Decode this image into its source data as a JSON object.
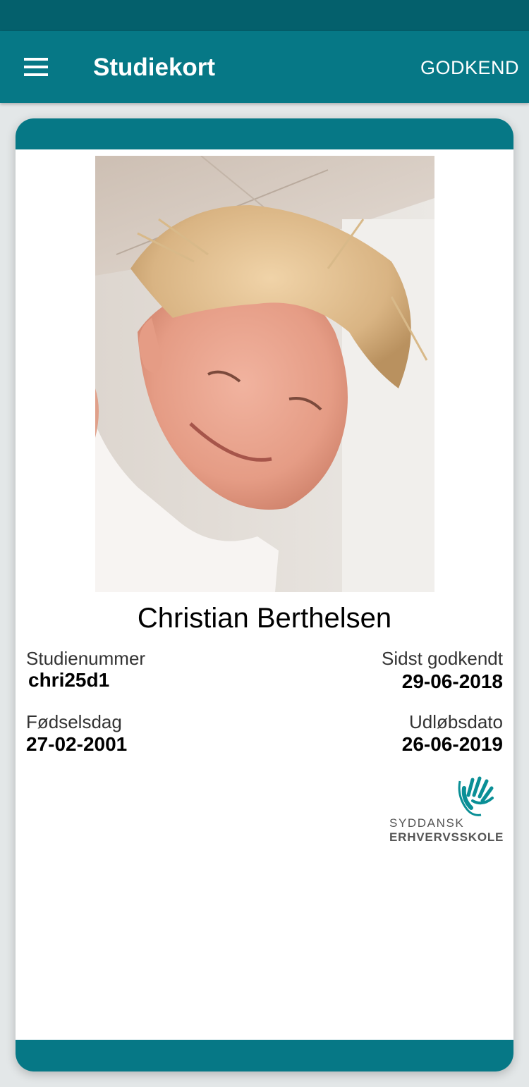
{
  "app_bar": {
    "title": "Studiekort",
    "approve_label": "GODKEND",
    "color": "#067886"
  },
  "card": {
    "name": "Christian Berthelsen",
    "student_number_label": "Studienummer",
    "student_number": "chri25d1",
    "last_approved_label": "Sidst godkendt",
    "last_approved": "29-06-2018",
    "birthday_label": "Fødselsdag",
    "birthday": "27-02-2001",
    "expiry_label": "Udløbsdato",
    "expiry": "26-06-2019"
  },
  "logo": {
    "line1": "SYDDANSK",
    "line2": "ERHVERVSSKOLE",
    "icon": "hand-icon",
    "color": "#0a8f96"
  },
  "icons": {
    "menu": "hamburger-menu-icon"
  }
}
